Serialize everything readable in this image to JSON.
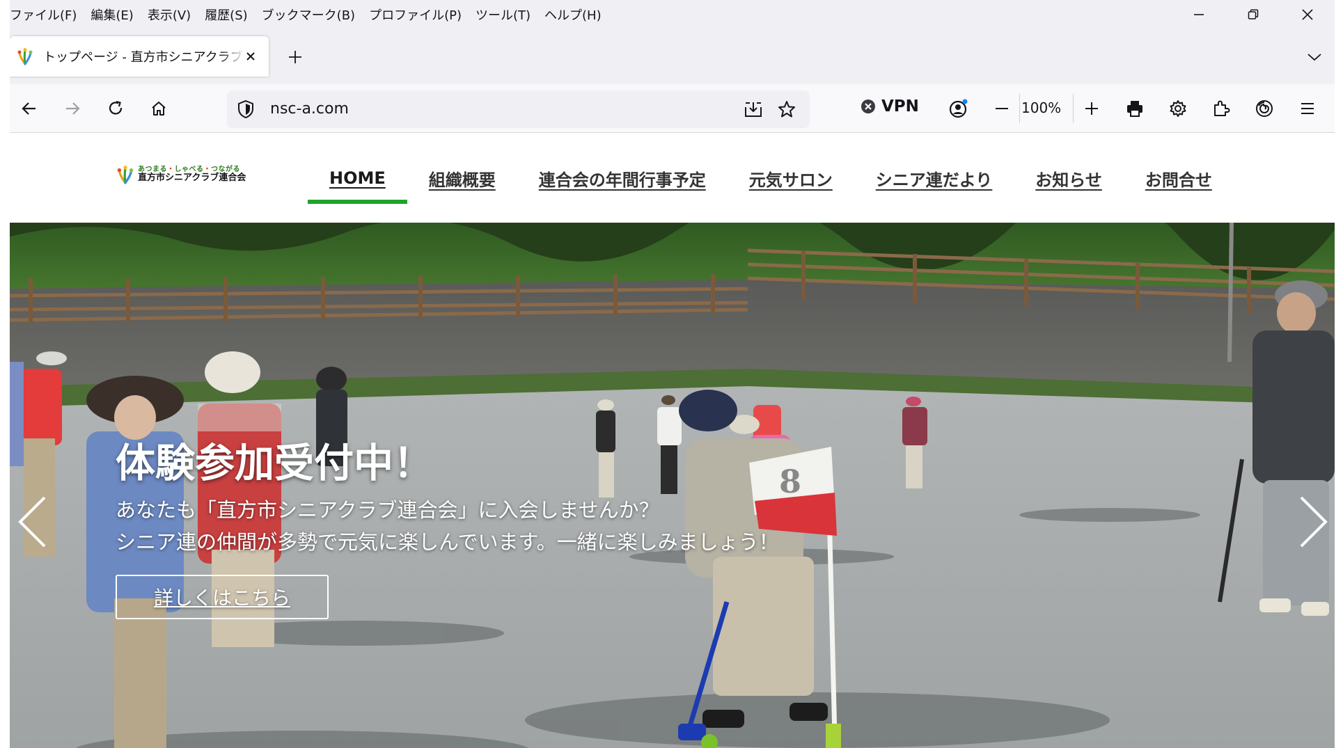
{
  "menubar": {
    "items": [
      "ファイル(F)",
      "編集(E)",
      "表示(V)",
      "履歴(S)",
      "ブックマーク(B)",
      "プロファイル(P)",
      "ツール(T)",
      "ヘルプ(H)"
    ]
  },
  "tab": {
    "title": "トップページ - 直方市シニアクラブ連合会"
  },
  "toolbar": {
    "url": "nsc-a.com",
    "vpn_label": "VPN",
    "zoom": "100%"
  },
  "site": {
    "logo_tagline_1": "あつまる",
    "logo_tagline_sep1": "・",
    "logo_tagline_2": "しゃべる",
    "logo_tagline_sep2": "・",
    "logo_tagline_3": "つながる",
    "logo_name": "直方市シニアクラブ連合会",
    "nav": [
      "HOME",
      "組織概要",
      "連合会の年間行事予定",
      "元気サロン",
      "シニア連だより",
      "お知らせ",
      "お問合せ"
    ]
  },
  "hero": {
    "title": "体験参加受付中！",
    "line1": "あなたも「直方市シニアクラブ連合会」に入会しませんか？",
    "line2": "シニア連の仲間が多勢で元気に楽しんでいます。一緒に楽しみましょう！",
    "button": "詳しくはこちら"
  },
  "colors": {
    "accent": "#1fa32a",
    "chrome_bg": "#f0f0f4"
  }
}
